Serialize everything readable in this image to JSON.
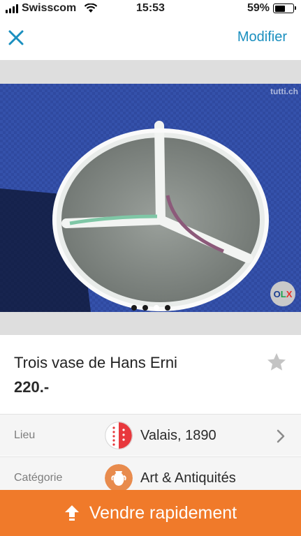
{
  "status_bar": {
    "carrier": "Swisscom",
    "time": "15:53",
    "battery_text": "59%",
    "battery_level": 0.59
  },
  "nav": {
    "close_icon": "close-icon",
    "modify_label": "Modifier",
    "accent_color": "#1a8fbf"
  },
  "gallery": {
    "watermark": "tutti.ch",
    "badge_letters": [
      "O",
      "L",
      "X"
    ],
    "image_count": 4,
    "active_index": 2
  },
  "listing": {
    "title": "Trois vase de Hans Erni",
    "price": "220.-",
    "favorite_icon": "star-icon"
  },
  "details": [
    {
      "label": "Lieu",
      "value": "Valais, 1890",
      "icon": "canton-flag-icon"
    },
    {
      "label": "Catégorie",
      "value": "Art & Antiquités",
      "icon": "vase-icon"
    }
  ],
  "footer": {
    "sell_label": "Vendre rapidement",
    "sell_color": "#f07a2a"
  }
}
